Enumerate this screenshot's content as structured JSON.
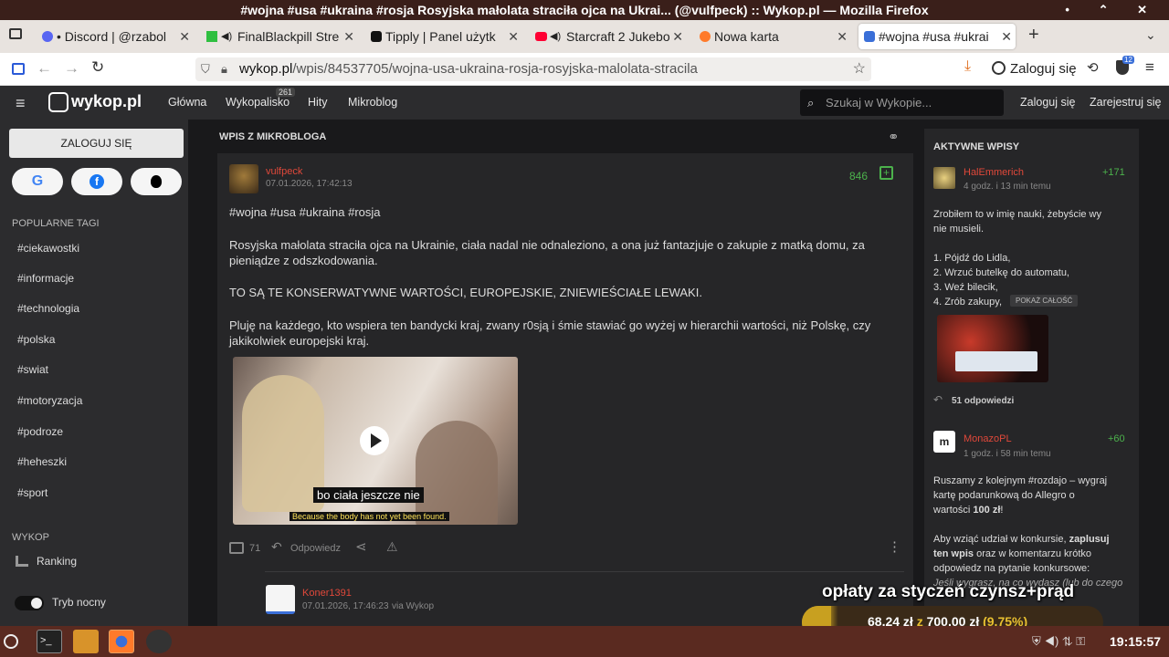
{
  "window": {
    "title": "#wojna #usa #ukraina #rosja Rosyjska małolata straciła ojca na Ukrai... (@vulfpeck) :: Wykop.pl — Mozilla Firefox",
    "buttons": [
      "•",
      "⌃",
      "✕"
    ]
  },
  "tabs": [
    {
      "label": "• Discord | @rzabol",
      "icon_color": "#5865f2"
    },
    {
      "label": "FinalBlackpill Stre",
      "icon_color": "#2fbf40"
    },
    {
      "label": "Tipply | Panel użytk",
      "icon_color": "#111111"
    },
    {
      "label": "Starcraft 2 Jukebo",
      "icon_color": "#ff0033"
    },
    {
      "label": "Nowa karta",
      "icon_color": "#ff7a2a"
    },
    {
      "label": "#wojna #usa #ukrai",
      "icon_color": "#3a6fd8"
    }
  ],
  "navbar": {
    "url_domain": "wykop.pl",
    "url_path": "/wpis/84537705/wojna-usa-ukraina-rosja-rosyjska-malolata-stracila",
    "login_label": "Zaloguj się",
    "ext_badge": "12"
  },
  "site": {
    "logo": "wykop.pl",
    "nav": [
      "Główna",
      "Wykopalisko",
      "Hity",
      "Mikroblog"
    ],
    "wykopalisko_count": "261",
    "search_placeholder": "Szukaj w Wykopie...",
    "login": "Zaloguj się",
    "register": "Zarejestruj się"
  },
  "sidebar": {
    "login_button": "ZALOGUJ SIĘ",
    "popular_tags_title": "POPULARNE TAGI",
    "tags": [
      "#ciekawostki",
      "#informacje",
      "#technologia",
      "#polska",
      "#swiat",
      "#motoryzacja",
      "#podroze",
      "#heheszki",
      "#sport"
    ],
    "wykop_title": "WYKOP",
    "ranking": "Ranking",
    "night_mode": "Tryb nocny"
  },
  "main": {
    "section_title": "WPIS Z MIKROBLOGA",
    "post": {
      "author": "vulfpeck",
      "date": "07.01.2026, 17:42:13",
      "votes": "846",
      "tags_line": "#wojna #usa #ukraina #rosja",
      "para1": "Rosyjska małolata straciła ojca na Ukrainie, ciała nadal nie odnaleziono, a ona już fantazjuje o zakupie z matką domu, za pieniądze z odszkodowania.",
      "para2": "TO SĄ TE KONSERWATYWNE WARTOŚCI, EUROPEJSKIE, ZNIEWIEŚCIAŁE LEWAKI.",
      "para3": "Pluję na każdego, kto wspiera ten bandycki kraj, zwany r0sją i śmie stawiać go wyżej w hierarchii wartości, niż Polskę, czy jakikolwiek europejski kraj.",
      "video_caption_pl": "bo ciała jeszcze nie",
      "video_caption_en": "Because the body has not yet been found.",
      "comments_count": "71",
      "reply_label": "Odpowiedz"
    },
    "comment": {
      "author": "Koner1391",
      "date": "07.01.2026, 17:46:23",
      "via": "via Wykop"
    }
  },
  "right": {
    "title": "AKTYWNE WPISY",
    "entry1": {
      "author": "HalEmmerich",
      "time": "4 godz. i 13 min temu",
      "votes": "+171",
      "line1": "Zrobiłem to w imię nauki, żebyście wy",
      "line2": "nie musieli.",
      "items": [
        "1. Pójdź do Lidla,",
        "2. Wrzuć butelkę do automatu,",
        "3. Weź bilecik,",
        "4. Zrób zakupy,"
      ],
      "show_all": "POKAŻ CAŁOŚĆ",
      "replies": "51 odpowiedzi"
    },
    "entry2": {
      "author": "MonazoPL",
      "time": "1 godz. i 58 min temu",
      "votes": "+60",
      "line1": "Ruszamy z kolejnym #rozdajo – wygraj",
      "line2": "kartę podarunkową do Allegro o",
      "line3a": "wartości ",
      "line3b": "100 zł",
      "line3c": "!",
      "line4a": "Aby wziąć udział w konkursie, ",
      "line4b": "zaplusuj",
      "line5a": "ten wpis",
      "line5b": " oraz w komentarzu krótko",
      "line6": "odpowiedz na pytanie konkursowe:",
      "line7": "Jeśli wygrasz, na co wydasz (lub do czego"
    }
  },
  "overlay": {
    "headline": "opłaty za styczeń czynsz+prąd",
    "amount": "68,24 zł",
    "of": "z",
    "goal": "700,00 zł",
    "percent": "(9.75%)",
    "progress_fraction": 0.0975
  },
  "taskbar": {
    "clock": "19:15:57"
  },
  "colors": {
    "accent_red": "#e0483a",
    "green_votes": "#4cb24c",
    "bg_dark": "#19191b",
    "panel": "#262628"
  }
}
